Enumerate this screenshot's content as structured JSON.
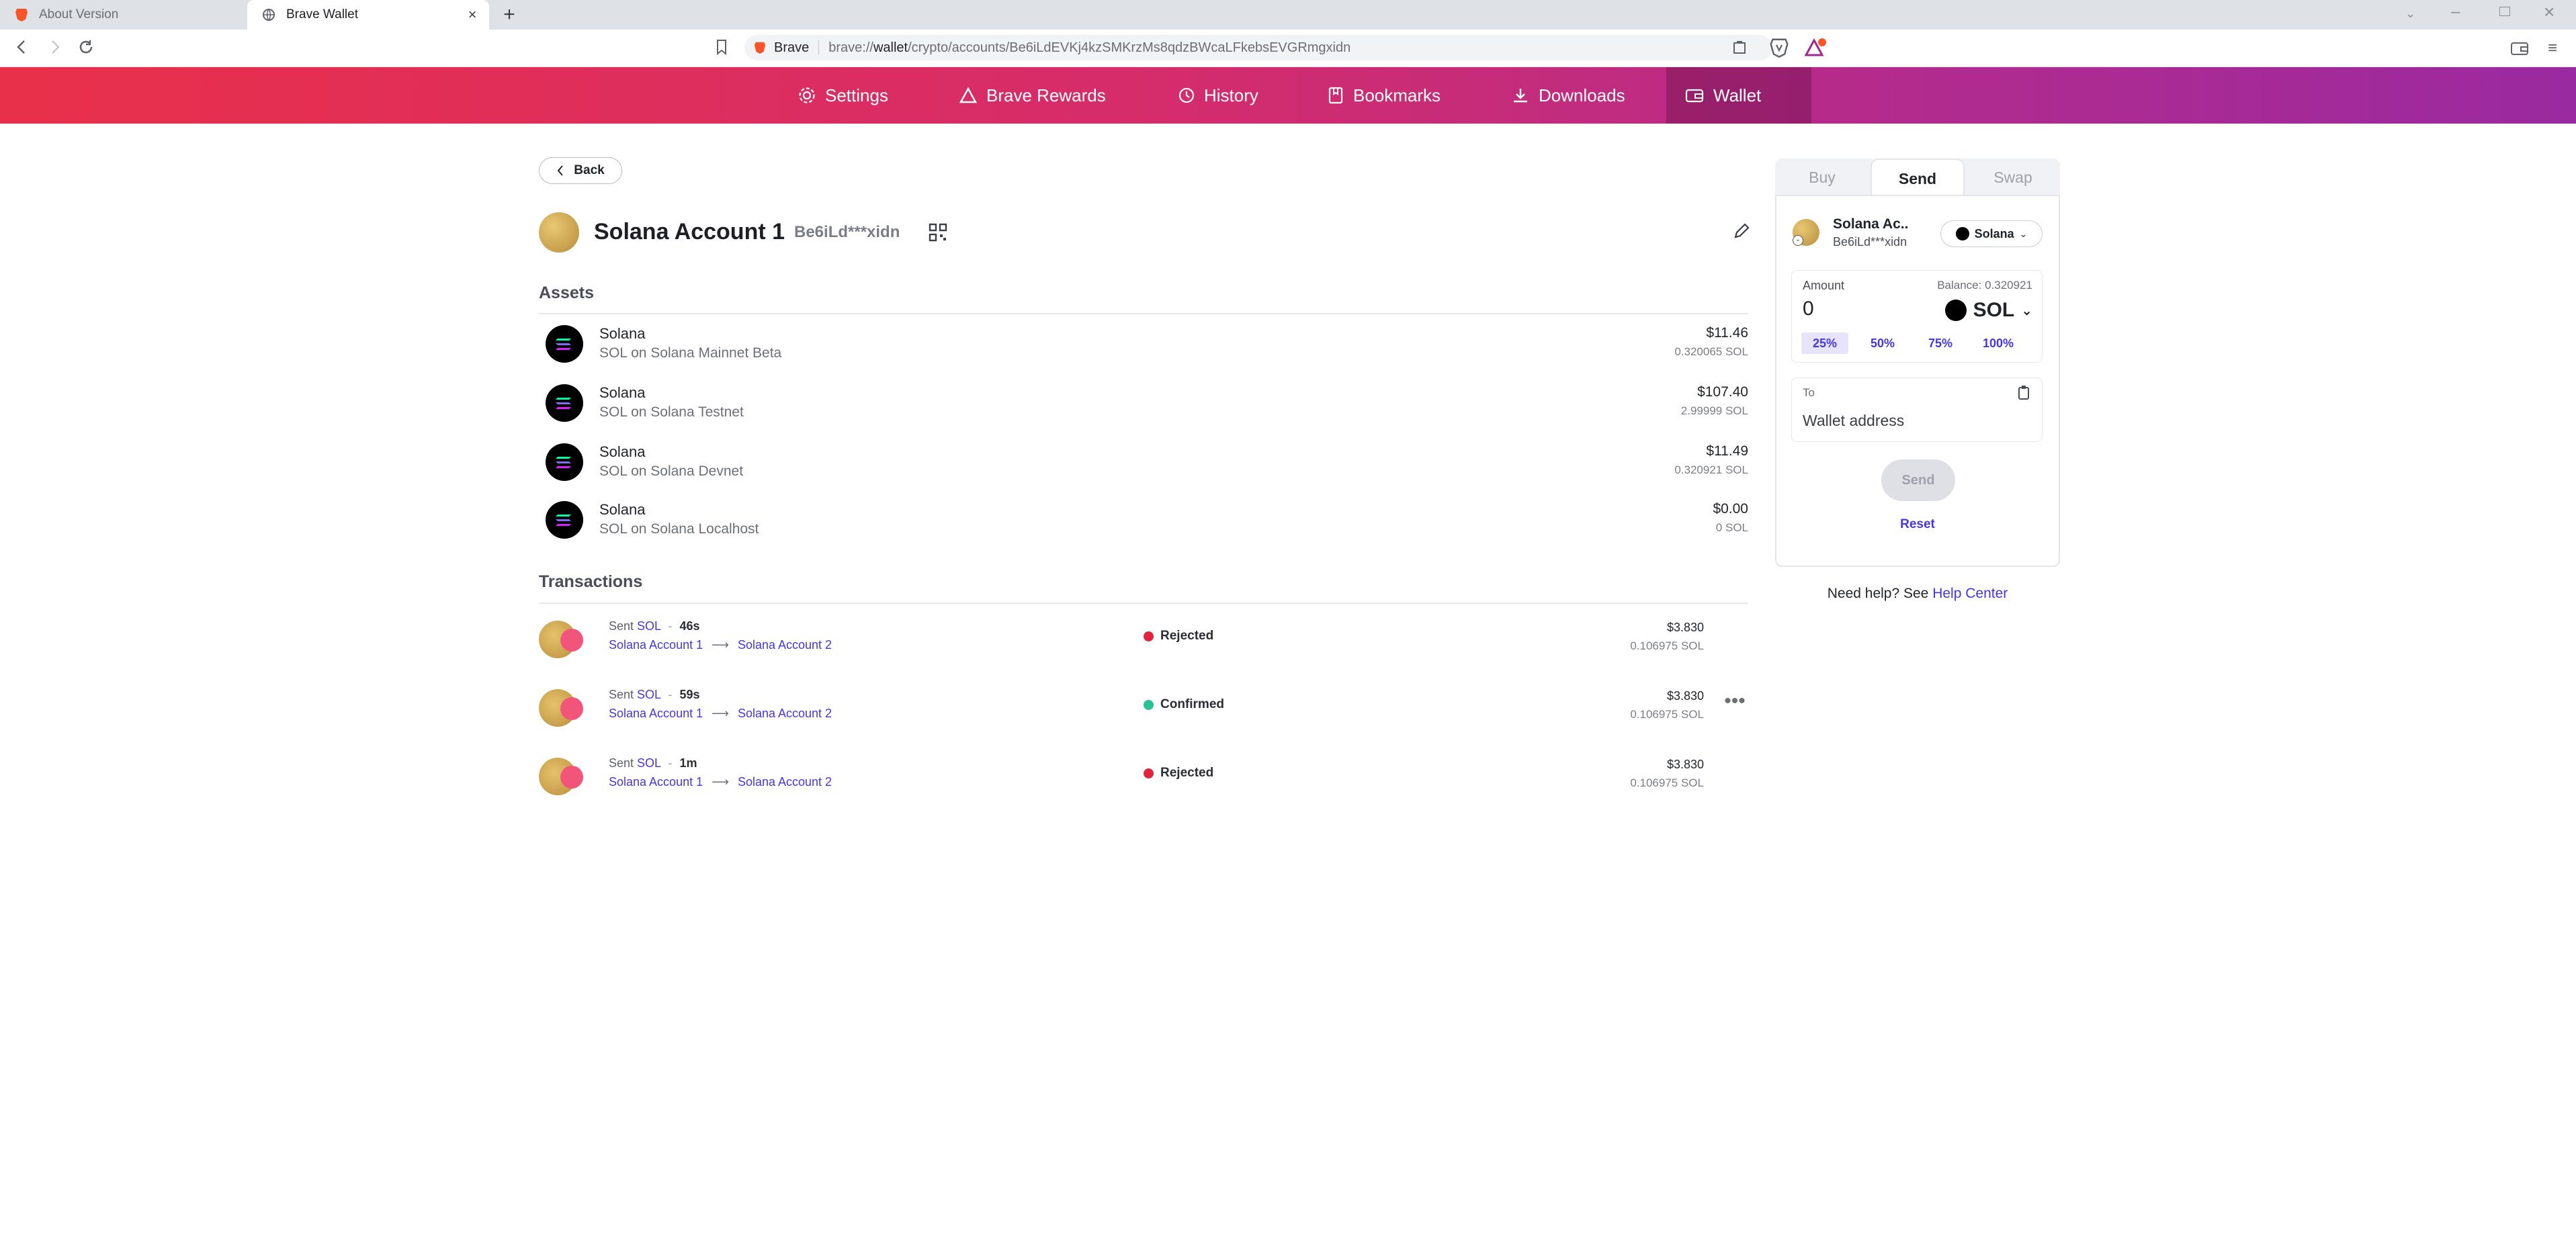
{
  "browser": {
    "tabs": [
      {
        "title": "About Version",
        "active": false
      },
      {
        "title": "Brave Wallet",
        "active": true
      }
    ],
    "url_prefix": "Brave",
    "url_scheme": "brave://",
    "url_host": "wallet",
    "url_path": "/crypto/accounts/Be6iLdEVKj4kzSMKrzMs8qdzBWcaLFkebsEVGRmgxidn",
    "brand_color": "#fb542b"
  },
  "nav": {
    "items": [
      {
        "label": "Settings",
        "icon": "gear-icon"
      },
      {
        "label": "Brave Rewards",
        "icon": "rewards-triangle-icon"
      },
      {
        "label": "History",
        "icon": "history-icon"
      },
      {
        "label": "Bookmarks",
        "icon": "bookmark-icon"
      },
      {
        "label": "Downloads",
        "icon": "download-icon"
      },
      {
        "label": "Wallet",
        "icon": "wallet-icon",
        "active": true
      }
    ]
  },
  "account": {
    "back_label": "Back",
    "name": "Solana Account 1",
    "address_short": "Be6iLd***xidn"
  },
  "assets": {
    "title": "Assets",
    "items": [
      {
        "name": "Solana",
        "network": "SOL on Solana Mainnet Beta",
        "usd": "$11.46",
        "amount": "0.320065 SOL"
      },
      {
        "name": "Solana",
        "network": "SOL on Solana Testnet",
        "usd": "$107.40",
        "amount": "2.99999 SOL"
      },
      {
        "name": "Solana",
        "network": "SOL on Solana Devnet",
        "usd": "$11.49",
        "amount": "0.320921 SOL"
      },
      {
        "name": "Solana",
        "network": "SOL on Solana Localhost",
        "usd": "$0.00",
        "amount": "0 SOL"
      }
    ]
  },
  "transactions": {
    "title": "Transactions",
    "items": [
      {
        "action": "Sent",
        "token": "SOL",
        "sep": "-",
        "time": "46s",
        "from": "Solana Account 1",
        "to": "Solana Account 2",
        "status": "Rejected",
        "status_color": "#e0243e",
        "usd": "$3.830",
        "amount": "0.106975 SOL"
      },
      {
        "action": "Sent",
        "token": "SOL",
        "sep": "-",
        "time": "59s",
        "from": "Solana Account 1",
        "to": "Solana Account 2",
        "status": "Confirmed",
        "status_color": "#2ac194",
        "usd": "$3.830",
        "amount": "0.106975 SOL"
      },
      {
        "action": "Sent",
        "token": "SOL",
        "sep": "-",
        "time": "1m",
        "from": "Solana Account 1",
        "to": "Solana Account 2",
        "status": "Rejected",
        "status_color": "#e0243e",
        "usd": "$3.830",
        "amount": "0.106975 SOL"
      }
    ]
  },
  "send_panel": {
    "tabs": [
      "Buy",
      "Send",
      "Swap"
    ],
    "active_tab": "Send",
    "account_name": "Solana Ac..",
    "account_address": "Be6iLd***xidn",
    "network": "Solana",
    "amount_label": "Amount",
    "balance_label": "Balance: 0.320921",
    "amount_value": "0",
    "token": "SOL",
    "percent_options": [
      "25%",
      "50%",
      "75%",
      "100%"
    ],
    "selected_percent": "25%",
    "to_label": "To",
    "address_placeholder": "Wallet address",
    "send_label": "Send",
    "reset_label": "Reset",
    "help_text": "Need help? See",
    "help_link": "Help Center"
  }
}
